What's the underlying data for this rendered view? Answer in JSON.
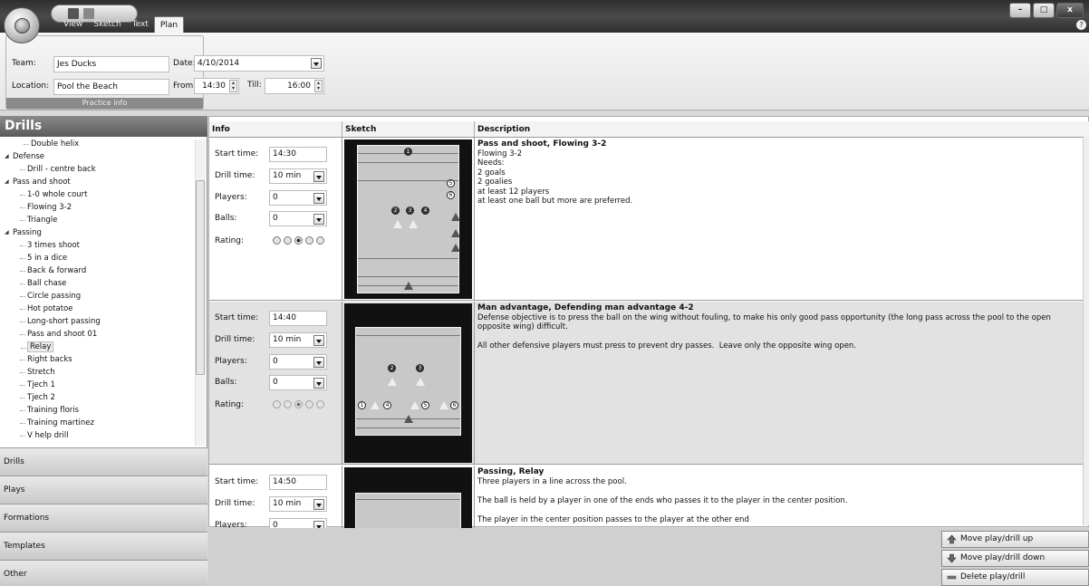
{
  "ribbon": {
    "tabs": [
      {
        "label": "View"
      },
      {
        "label": "Sketch"
      },
      {
        "label": "Text"
      },
      {
        "label": "Plan"
      }
    ],
    "practice_info": {
      "team_label": "Team:",
      "team_value": "Jes Ducks",
      "location_label": "Location:",
      "location_value": "Pool the Beach",
      "date_label": "Date:",
      "date_value": "4/10/2014",
      "from_label": "From:",
      "from_value": "14:30",
      "till_label": "Till:",
      "till_value": "16:00",
      "caption": "Practice info"
    }
  },
  "left_panel": {
    "title": "Drills",
    "tree": [
      {
        "label": "Double helix",
        "type": "leaf"
      },
      {
        "label": "Defense",
        "type": "cat"
      },
      {
        "label": "Drill - centre back",
        "type": "leaf"
      },
      {
        "label": "Pass and shoot",
        "type": "cat"
      },
      {
        "label": "1-0 whole court",
        "type": "leaf"
      },
      {
        "label": "Flowing 3-2",
        "type": "leaf"
      },
      {
        "label": "Triangle",
        "type": "leaf"
      },
      {
        "label": "Passing",
        "type": "cat"
      },
      {
        "label": "3 times shoot",
        "type": "leaf"
      },
      {
        "label": "5 in a dice",
        "type": "leaf"
      },
      {
        "label": "Back & forward",
        "type": "leaf"
      },
      {
        "label": "Ball chase",
        "type": "leaf"
      },
      {
        "label": "Circle passing",
        "type": "leaf"
      },
      {
        "label": "Hot potatoe",
        "type": "leaf"
      },
      {
        "label": "Long-short passing",
        "type": "leaf"
      },
      {
        "label": "Pass and shoot 01",
        "type": "leaf"
      },
      {
        "label": "Relay",
        "type": "leaf",
        "selected": true
      },
      {
        "label": "Right backs",
        "type": "leaf"
      },
      {
        "label": "Stretch",
        "type": "leaf"
      },
      {
        "label": "Tjech 1",
        "type": "leaf"
      },
      {
        "label": "Tjech 2",
        "type": "leaf"
      },
      {
        "label": "Training floris",
        "type": "leaf"
      },
      {
        "label": "Training martinez",
        "type": "leaf"
      },
      {
        "label": "V help drill",
        "type": "leaf"
      }
    ],
    "nav": [
      {
        "label": "Drills"
      },
      {
        "label": "Plays"
      },
      {
        "label": "Formations"
      },
      {
        "label": "Templates"
      },
      {
        "label": "Other"
      }
    ]
  },
  "grid": {
    "headers": {
      "info": "Info",
      "sketch": "Sketch",
      "description": "Description"
    },
    "labels": {
      "start": "Start time:",
      "drill": "Drill time:",
      "players": "Players:",
      "balls": "Balls:",
      "rating": "Rating:"
    },
    "rows": [
      {
        "start": "14:30",
        "drill": "10 min",
        "players": "0",
        "balls": "0",
        "rating": 3,
        "title": "Pass and shoot, Flowing 3-2",
        "body": "Flowing 3-2\nNeeds:\n2 goals\n2 goalies\nat least 12 players\nat least one ball but more are preferred."
      },
      {
        "start": "14:40",
        "drill": "10 min",
        "players": "0",
        "balls": "0",
        "rating": 3,
        "title": "Man advantage, Defending man advantage 4-2",
        "body": "Defense objective is to press the ball on the wing without fouling, to make his only good pass opportunity (the long pass across the pool to the open opposite wing) difficult.\n\nAll other defensive players must press to prevent dry passes.  Leave only the opposite wing open."
      },
      {
        "start": "14:50",
        "drill": "10 min",
        "players": "0",
        "title": "Passing, Relay",
        "body": "Three players in a line across the pool.\n\nThe ball is held by a player in one of the ends who passes it to the player in the center position.\n\nThe player in the center position passes to the player at the other end"
      }
    ]
  },
  "buttons": {
    "up": "Move play/drill up",
    "down": "Move play/drill down",
    "delete": "Delete play/drill"
  }
}
